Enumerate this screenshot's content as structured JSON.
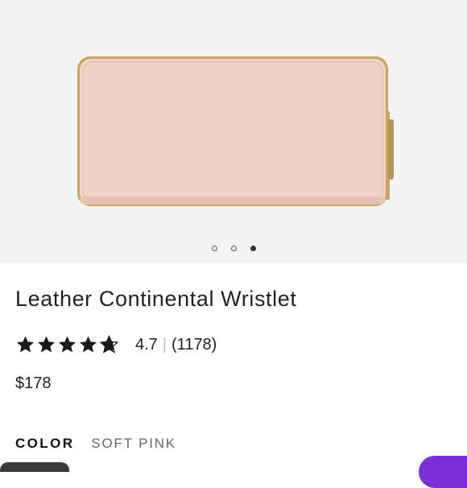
{
  "product": {
    "name": "Leather Continental Wristlet",
    "rating": "4.7",
    "rating_fraction": 0.94,
    "review_count": "(1178)",
    "price": "$178",
    "color_label": "COLOR",
    "color_value": "SOFT PINK"
  },
  "gallery": {
    "image_count": 3,
    "active_index": 2
  },
  "colors": {
    "wallet": "#f2d3c8",
    "wallet_shadow": "#e8c2b6",
    "zipper": "#c8a560",
    "chat_accent": "#7b2fd6"
  }
}
